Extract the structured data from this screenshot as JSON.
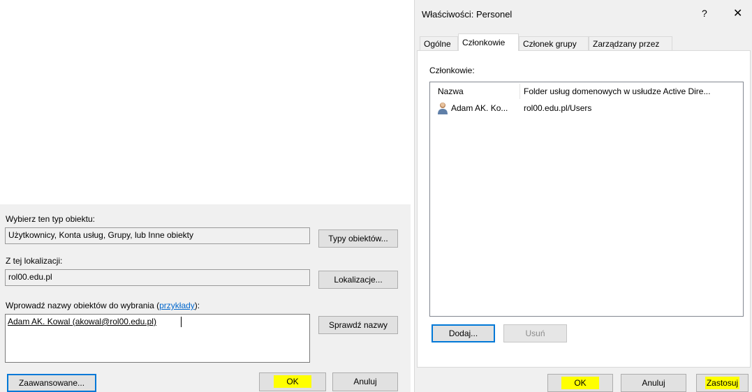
{
  "select_dialog": {
    "object_type_label": "Wybierz ten typ obiektu:",
    "object_type_value": "Użytkownicy, Konta usług, Grupy, lub Inne obiekty",
    "object_types_button": "Typy obiektów...",
    "location_label": "Z tej lokalizacji:",
    "location_value": "rol00.edu.pl",
    "locations_button": "Lokalizacje...",
    "names_label_prefix": "Wprowadź nazwy obiektów do wybrania (",
    "names_label_link": "przykłady",
    "names_label_suffix": "):",
    "names_value": "Adam AK. Kowal (akowal@rol00.edu.pl)",
    "check_names_button": "Sprawdź nazwy",
    "advanced_button": "Zaawansowane...",
    "ok_button": "OK",
    "cancel_button": "Anuluj"
  },
  "properties_dialog": {
    "title": "Właściwości: Personel",
    "help_glyph": "?",
    "close_glyph": "✕",
    "tabs": [
      "Ogólne",
      "Członkowie",
      "Członek grupy",
      "Zarządzany przez"
    ],
    "active_tab": "Członkowie",
    "members_label": "Członkowie:",
    "columns": [
      "Nazwa",
      "Folder usług domenowych w usłudze Active Dire..."
    ],
    "rows": [
      {
        "name": "Adam AK. Ko...",
        "folder": "rol00.edu.pl/Users",
        "icon": "user-icon"
      }
    ],
    "add_button": "Dodaj...",
    "remove_button": "Usuń",
    "ok_button": "OK",
    "cancel_button": "Anuluj",
    "apply_button": "Zastosuj"
  },
  "colors": {
    "highlight": "#ffff00",
    "focus_border": "#0078d7",
    "dialog_bg": "#f0f0f0",
    "link": "#0066cc"
  }
}
